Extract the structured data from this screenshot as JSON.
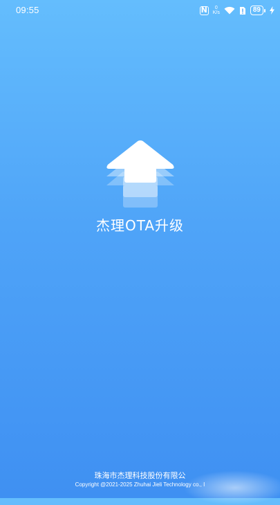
{
  "status_bar": {
    "time": "09:55",
    "nfc_label": "N",
    "net_speed_value": "0",
    "net_speed_unit": "K/s",
    "battery_percent": "89",
    "icons": [
      "nfc-icon",
      "network-speed-icon",
      "wifi-icon",
      "sim-alert-icon",
      "battery-icon",
      "charging-icon"
    ]
  },
  "app": {
    "title": "杰理OTA升级",
    "logo_icon": "upload-arrow-icon"
  },
  "footer": {
    "company": "珠海市杰理科技股份有限公",
    "copyright": "Copyright @2021-2025 Zhuhai Jieli Technology co., I"
  },
  "colors": {
    "background_top": "#64bdfd",
    "background_bottom": "#3f90f2",
    "foreground": "#ffffff"
  }
}
